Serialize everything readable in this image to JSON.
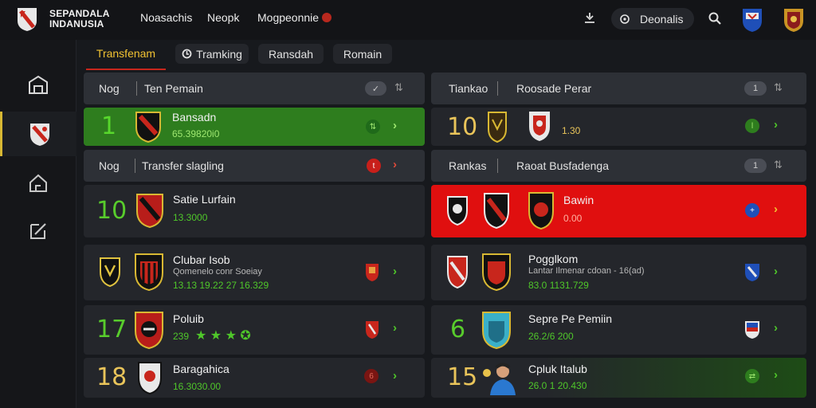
{
  "brand": {
    "line1": "SEPANDALA",
    "line2": "INDANUSIA"
  },
  "top_nav": [
    "Noasachis",
    "Neopk",
    "Mogpeonnie"
  ],
  "search_pill": {
    "label": "Deonalis"
  },
  "tabs": [
    "Transfenam",
    "Tramking",
    "Ransdah",
    "Romain"
  ],
  "left": {
    "panel1_header": {
      "col1": "Nog",
      "col2": "Ten Pemain"
    },
    "panel1_row": {
      "rank": "1",
      "name": "Bansadn",
      "value": "65.39820i0"
    },
    "panel2_header": {
      "col1": "Nog",
      "col2": "Transfer slagling"
    },
    "panel2_rows": [
      {
        "rank": "10",
        "name": "Satie Lurfain",
        "sub": "",
        "value": "13.3000"
      },
      {
        "rank": "",
        "name": "Clubar Isob",
        "sub": "Qomenelo conr Soeiay",
        "value": "13.13 19.22 27 16.329"
      },
      {
        "rank": "17",
        "name": "Poluib",
        "sub": "",
        "value": "239"
      },
      {
        "rank": "18",
        "name": "Baragahica",
        "sub": "",
        "value": "16.3030.00"
      }
    ]
  },
  "right": {
    "panel1_header": {
      "col1": "Tiankao",
      "col2": "Roosade Perar",
      "count": "1"
    },
    "panel1_row": {
      "rank": "10",
      "value": "1.30"
    },
    "panel2_header": {
      "col1": "Rankas",
      "col2": "Raoat Busfadenga",
      "count": "1"
    },
    "panel2_rows": [
      {
        "rank": "",
        "name": "Bawin",
        "sub": "",
        "value": "0.00"
      },
      {
        "rank": "",
        "name": "Pogglkom",
        "sub": "Lantar Ilmenar cdoan - 16(ad)",
        "value": "83.0 1131.729"
      },
      {
        "rank": "6",
        "name": "Sepre Pe Pemiin",
        "sub": "",
        "value": "26.2/6 200"
      },
      {
        "rank": "15",
        "name": "Cpluk Italub",
        "sub": "",
        "value": "26.0 1 20.430"
      }
    ]
  },
  "colors": {
    "accent": "#f1c232",
    "green": "#4fc72a",
    "red": "#e00f0f",
    "bg": "#17191d"
  }
}
